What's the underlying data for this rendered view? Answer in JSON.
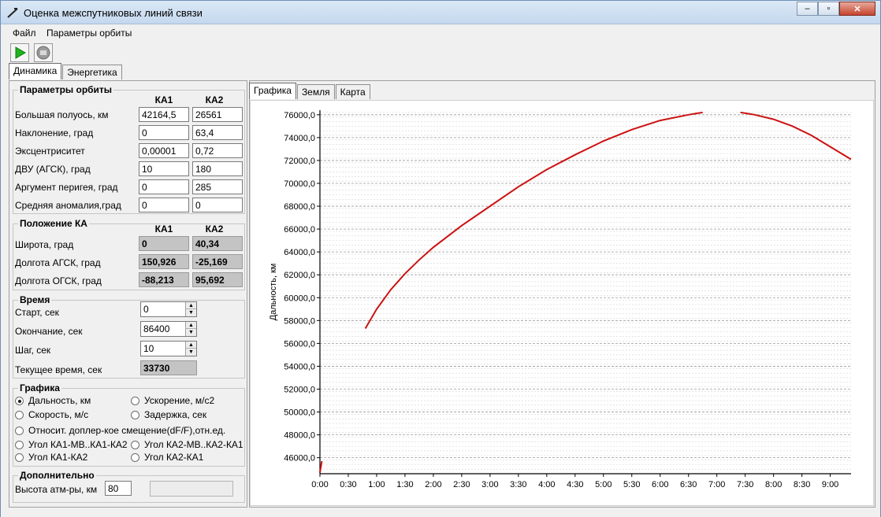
{
  "window": {
    "title": "Оценка межспутниковых линий связи",
    "minimize": "‒",
    "maximize": "▫",
    "close": "✕"
  },
  "menu": {
    "items": [
      "Файл",
      "Параметры орбиты"
    ]
  },
  "toolbar": {
    "play_icon": "play-icon",
    "stop_icon": "stop-icon"
  },
  "main_tabs": [
    "Динамика",
    "Энергетика"
  ],
  "orbit": {
    "legend": "Параметры орбиты",
    "col1": "КА1",
    "col2": "КА2",
    "rows": [
      {
        "label": "Большая полуось, км",
        "ka1": "42164,5",
        "ka2": "26561"
      },
      {
        "label": "Наклонение, град",
        "ka1": "0",
        "ka2": "63,4"
      },
      {
        "label": "Эксцентриситет",
        "ka1": "0,00001",
        "ka2": "0,72"
      },
      {
        "label": "ДВУ (АГСК), град",
        "ka1": "10",
        "ka2": "180"
      },
      {
        "label": "Аргумент перигея, град",
        "ka1": "0",
        "ka2": "285"
      },
      {
        "label": "Средняя аномалия,град",
        "ka1": "0",
        "ka2": "0"
      }
    ]
  },
  "position": {
    "legend": "Положение КА",
    "col1": "КА1",
    "col2": "КА2",
    "rows": [
      {
        "label": "Широта, град",
        "ka1": "0",
        "ka2": "40,34"
      },
      {
        "label": "Долгота АГСК, град",
        "ka1": "150,926",
        "ka2": "-25,169"
      },
      {
        "label": "Долгота ОГСК, град",
        "ka1": "-88,213",
        "ka2": "95,692"
      }
    ]
  },
  "time": {
    "legend": "Время",
    "start_label": "Старт, сек",
    "start": "0",
    "end_label": "Окончание, сек",
    "end": "86400",
    "step_label": "Шаг, сек",
    "step": "10",
    "current_label": "Текущее время, сек",
    "current": "33730"
  },
  "graphs": {
    "legend": "Графика",
    "options": [
      "Дальность, км",
      "Ускорение, м/с2",
      "Скорость, м/с",
      "Задержка, сек",
      "Относит. доплер-кое смещение(dF/F),отн.ед.",
      "Угол КА1-МВ..КА1-КА2",
      "Угол КА2-МВ..КА2-КА1",
      "Угол КА1-КА2",
      "Угол КА2-КА1"
    ],
    "selected": "Дальность, км"
  },
  "extra": {
    "legend": "Дополнительно",
    "atm_label": "Высота атм-ры, км",
    "atm_value": "80"
  },
  "right_tabs": [
    "Графика",
    "Земля",
    "Карта"
  ],
  "chart_data": {
    "type": "line",
    "ylabel": "Дальность, км",
    "xlabel": "",
    "y_ticks": [
      "46000,0",
      "48000,0",
      "50000,0",
      "52000,0",
      "54000,0",
      "56000,0",
      "58000,0",
      "60000,0",
      "62000,0",
      "64000,0",
      "66000,0",
      "68000,0",
      "70000,0",
      "72000,0",
      "74000,0",
      "76000,0"
    ],
    "x_ticks": [
      "0:00",
      "0:30",
      "1:00",
      "1:30",
      "2:00",
      "2:30",
      "3:00",
      "3:30",
      "4:00",
      "4:30",
      "5:00",
      "5:30",
      "6:00",
      "6:30",
      "7:00",
      "7:30",
      "8:00",
      "8:30",
      "9:00"
    ],
    "ylim": [
      44600,
      76400
    ],
    "xlim_minutes": [
      0,
      562
    ],
    "grid": true,
    "color": "#cc1111",
    "series": [
      {
        "x": [
          0,
          2
        ],
        "y": [
          44700,
          45700
        ]
      },
      {
        "x": [
          48,
          60,
          75,
          90,
          105,
          120,
          150,
          180,
          210,
          240,
          270,
          300,
          330,
          360,
          390,
          405
        ],
        "y": [
          57300,
          59000,
          60700,
          62100,
          63300,
          64400,
          66300,
          68000,
          69700,
          71200,
          72500,
          73700,
          74700,
          75500,
          76000,
          76200
        ]
      },
      {
        "x": [
          445,
          460,
          480,
          500,
          520,
          540,
          562
        ],
        "y": [
          76200,
          76000,
          75600,
          75000,
          74200,
          73200,
          72100
        ]
      }
    ]
  }
}
